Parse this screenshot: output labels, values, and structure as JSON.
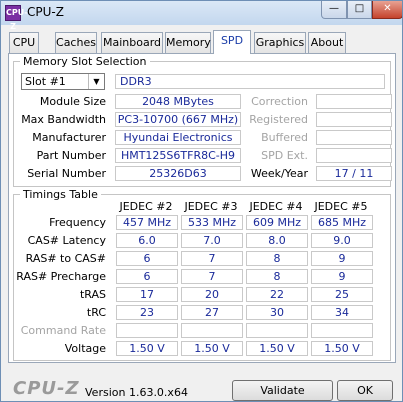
{
  "window": {
    "title": "CPU-Z",
    "icon_label": "CPU-Z",
    "minimize_glyph": "—",
    "maximize_glyph": "□",
    "close_glyph": "✕"
  },
  "tabs": [
    {
      "label": "CPU",
      "active": false
    },
    {
      "label": "Caches",
      "active": false
    },
    {
      "label": "Mainboard",
      "active": false
    },
    {
      "label": "Memory",
      "active": false
    },
    {
      "label": "SPD",
      "active": true
    },
    {
      "label": "Graphics",
      "active": false
    },
    {
      "label": "About",
      "active": false
    }
  ],
  "memory_slot": {
    "title": "Memory Slot Selection",
    "slot_value": "Slot #1",
    "slot_options": [
      "Slot #1"
    ],
    "dropdown_icon": "chevron-down-icon",
    "type": "DDR3",
    "module_size_label": "Module Size",
    "module_size": "2048 MBytes",
    "max_bandwidth_label": "Max Bandwidth",
    "max_bandwidth": "PC3-10700 (667 MHz)",
    "manufacturer_label": "Manufacturer",
    "manufacturer": "Hyundai Electronics",
    "part_number_label": "Part Number",
    "part_number": "HMT125S6TFR8C-H9",
    "serial_number_label": "Serial Number",
    "serial_number": "25326D63",
    "correction_label": "Correction",
    "registered_label": "Registered",
    "buffered_label": "Buffered",
    "spd_ext_label": "SPD Ext.",
    "week_year_label": "Week/Year",
    "week_year": "17 / 11"
  },
  "timings": {
    "title": "Timings Table",
    "columns": [
      "JEDEC #2",
      "JEDEC #3",
      "JEDEC #4",
      "JEDEC #5"
    ],
    "rows": [
      {
        "label": "Frequency",
        "values": [
          "457 MHz",
          "533 MHz",
          "609 MHz",
          "685 MHz"
        ]
      },
      {
        "label": "CAS# Latency",
        "values": [
          "6.0",
          "7.0",
          "8.0",
          "9.0"
        ]
      },
      {
        "label": "RAS# to CAS#",
        "values": [
          "6",
          "7",
          "8",
          "9"
        ]
      },
      {
        "label": "RAS# Precharge",
        "values": [
          "6",
          "7",
          "8",
          "9"
        ]
      },
      {
        "label": "tRAS",
        "values": [
          "17",
          "20",
          "22",
          "25"
        ]
      },
      {
        "label": "tRC",
        "values": [
          "23",
          "27",
          "30",
          "34"
        ]
      },
      {
        "label": "Command Rate",
        "values": [
          "",
          "",
          "",
          ""
        ],
        "disabled": true
      },
      {
        "label": "Voltage",
        "values": [
          "1.50 V",
          "1.50 V",
          "1.50 V",
          "1.50 V"
        ]
      }
    ]
  },
  "footer": {
    "logo": "CPU-Z",
    "version": "Version 1.63.0.x64",
    "validate_label": "Validate",
    "ok_label": "OK"
  }
}
